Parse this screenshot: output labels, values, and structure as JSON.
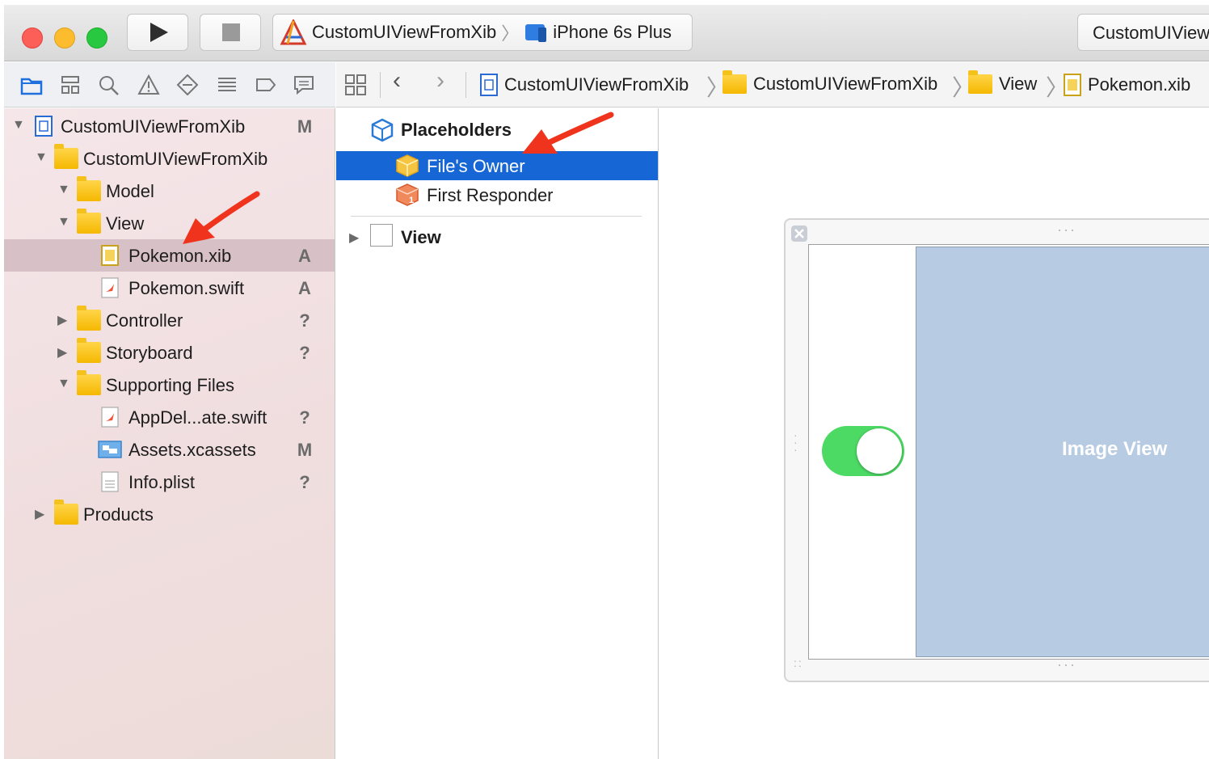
{
  "window": {
    "scheme_target": "CustomUIViewFromXib",
    "scheme_device": "iPhone 6s Plus",
    "activity_text": "CustomUIView"
  },
  "jumpbar": {
    "crumbs": [
      "CustomUIViewFromXib",
      "CustomUIViewFromXib",
      "View",
      "Pokemon.xib"
    ]
  },
  "navigator": {
    "project": {
      "label": "CustomUIViewFromXib",
      "badge": "M"
    },
    "group": {
      "label": "CustomUIViewFromXib"
    },
    "items": [
      {
        "label": "Model",
        "badge": ""
      },
      {
        "label": "View",
        "badge": ""
      },
      {
        "label": "Pokemon.xib",
        "badge": "A"
      },
      {
        "label": "Pokemon.swift",
        "badge": "A"
      },
      {
        "label": "Controller",
        "badge": "?"
      },
      {
        "label": "Storyboard",
        "badge": "?"
      },
      {
        "label": "Supporting Files",
        "badge": ""
      },
      {
        "label": "AppDel...ate.swift",
        "badge": "?"
      },
      {
        "label": "Assets.xcassets",
        "badge": "M"
      },
      {
        "label": "Info.plist",
        "badge": "?"
      },
      {
        "label": "Products",
        "badge": ""
      }
    ]
  },
  "outline": {
    "placeholders_label": "Placeholders",
    "files_owner_label": "File's Owner",
    "first_responder_label": "First Responder",
    "view_label": "View"
  },
  "canvas": {
    "image_view_label": "Image View",
    "switch_on": true
  },
  "colors": {
    "selection_blue": "#1766d6",
    "switch_green": "#4cd964",
    "image_view_fill": "#b7cbe3",
    "annotation_arrow": "#f0331c"
  }
}
